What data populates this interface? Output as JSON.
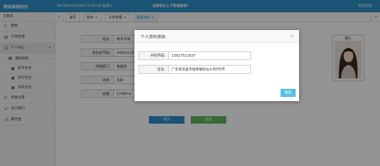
{
  "header": {
    "brand": "物流系统后台",
    "datetime": "2019年01月16日 11:20:59 星期三",
    "notice": "注册有关上下限调查询！",
    "user": "欢迎光临"
  },
  "sidebar": {
    "title": "主菜单",
    "items": [
      {
        "label": "签到"
      },
      {
        "label": "订单管理"
      },
      {
        "label": "个人中心"
      },
      {
        "label": "基础资料"
      },
      {
        "label": "账号安全"
      },
      {
        "label": "支付安全"
      },
      {
        "label": "系统信息"
      },
      {
        "label": "资金记录"
      },
      {
        "label": "关于我们"
      },
      {
        "label": "聊天室"
      }
    ]
  },
  "tabs": [
    {
      "label": "首页"
    },
    {
      "label": "签到"
    },
    {
      "label": "订单管理"
    },
    {
      "label": "基础资料"
    }
  ],
  "profile": {
    "fields": [
      {
        "label": "姓名:",
        "value": "黄月月相"
      },
      {
        "label": "身份证号码:",
        "value": "440921199"
      },
      {
        "label": "所属部门:",
        "value": "客服部"
      },
      {
        "label": "状态:",
        "value": "在职"
      },
      {
        "label": "余额:",
        "value": "17484.6"
      }
    ],
    "avatar_label": "照片",
    "submit_label": "提交",
    "reset_label": "重置"
  },
  "modal": {
    "title": "个人资料修改:",
    "close": "×",
    "phone_label": "手机号码:",
    "phone_value": "13927512637",
    "address_label": "住址:",
    "address_value": "广东省信宜市钱排镇双合头背村5号",
    "button_label": "修改"
  },
  "colors": {
    "header_bg": "#2e8fc6",
    "accent": "#2e8fc6",
    "modal_button": "#5bc0de",
    "reset_button": "#5cb85c"
  }
}
